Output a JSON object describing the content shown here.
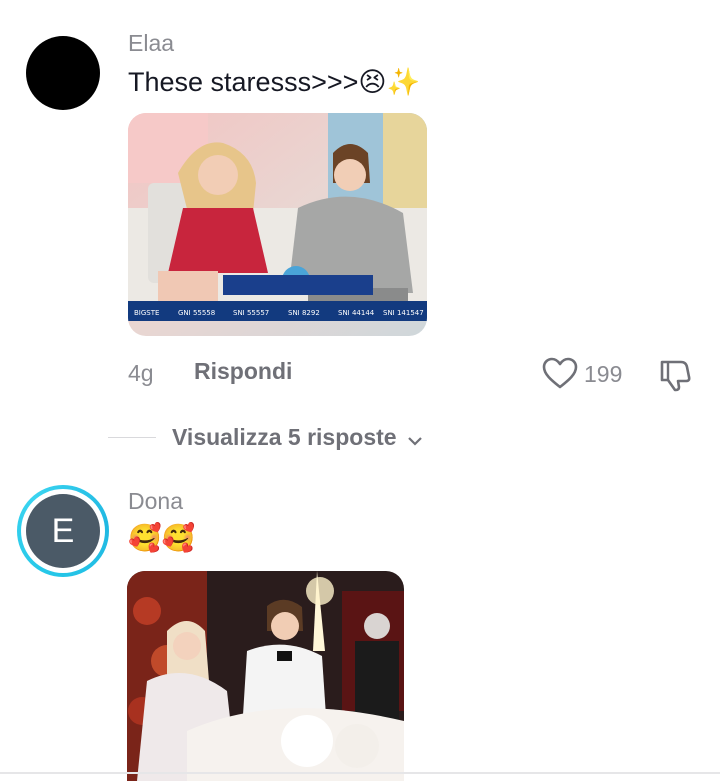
{
  "comments": [
    {
      "username": "Elaa",
      "text": "These staresss>>>",
      "emoji": "😣✨",
      "age": "4g",
      "reply_label": "Rispondi",
      "likes": "199",
      "view_replies": "Visualizza 5 risposte",
      "overlay_strip": [
        "BIGSTE",
        "GNI 55558",
        "SNI 55557",
        "SNI 8292",
        "SNI 44144",
        "SNI 141547"
      ]
    },
    {
      "username": "Dona",
      "avatar_letter": "E",
      "emoji": "🥰🥰"
    }
  ],
  "colors": {
    "username": "#8a8b91",
    "text": "#161823",
    "ring": "#25c7e8",
    "avatar_bg": "#4b5a67"
  }
}
